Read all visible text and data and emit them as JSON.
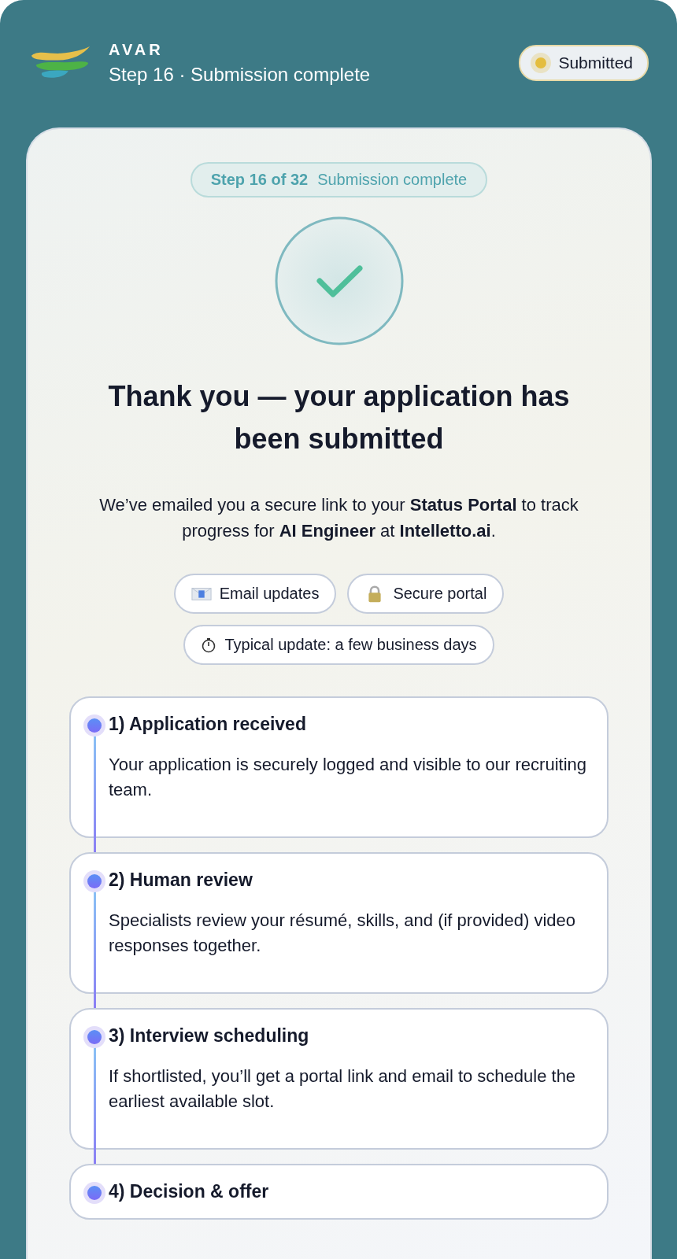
{
  "header": {
    "brand": "AVAR",
    "subtitle": "Step 16 · Submission complete",
    "status_badge": "Submitted"
  },
  "step_pill": {
    "step": "Step 16 of 32",
    "label": "Submission complete"
  },
  "heading": "Thank you — your application has been submitted",
  "message": "We’ve emailed you a secure link to your **Status Portal** to track progress for **AI Engineer** at **Intelletto.ai**.",
  "chips": [
    {
      "kind": "email",
      "label": "Email updates"
    },
    {
      "kind": "lock",
      "label": "Secure portal"
    },
    {
      "kind": "timer",
      "label": "Typical update: a few business days"
    }
  ],
  "steps": [
    {
      "title": "1) Application received",
      "text": "Your application is securely logged and visible to our recruiting team."
    },
    {
      "title": "2) Human review",
      "text": "Specialists review your résumé, skills, and (if provided) video responses together."
    },
    {
      "title": "3) Interview scheduling",
      "text": "If shortlisted, you’ll get a portal link and email to schedule the earliest available slot."
    },
    {
      "title": "4) Decision & offer"
    }
  ]
}
